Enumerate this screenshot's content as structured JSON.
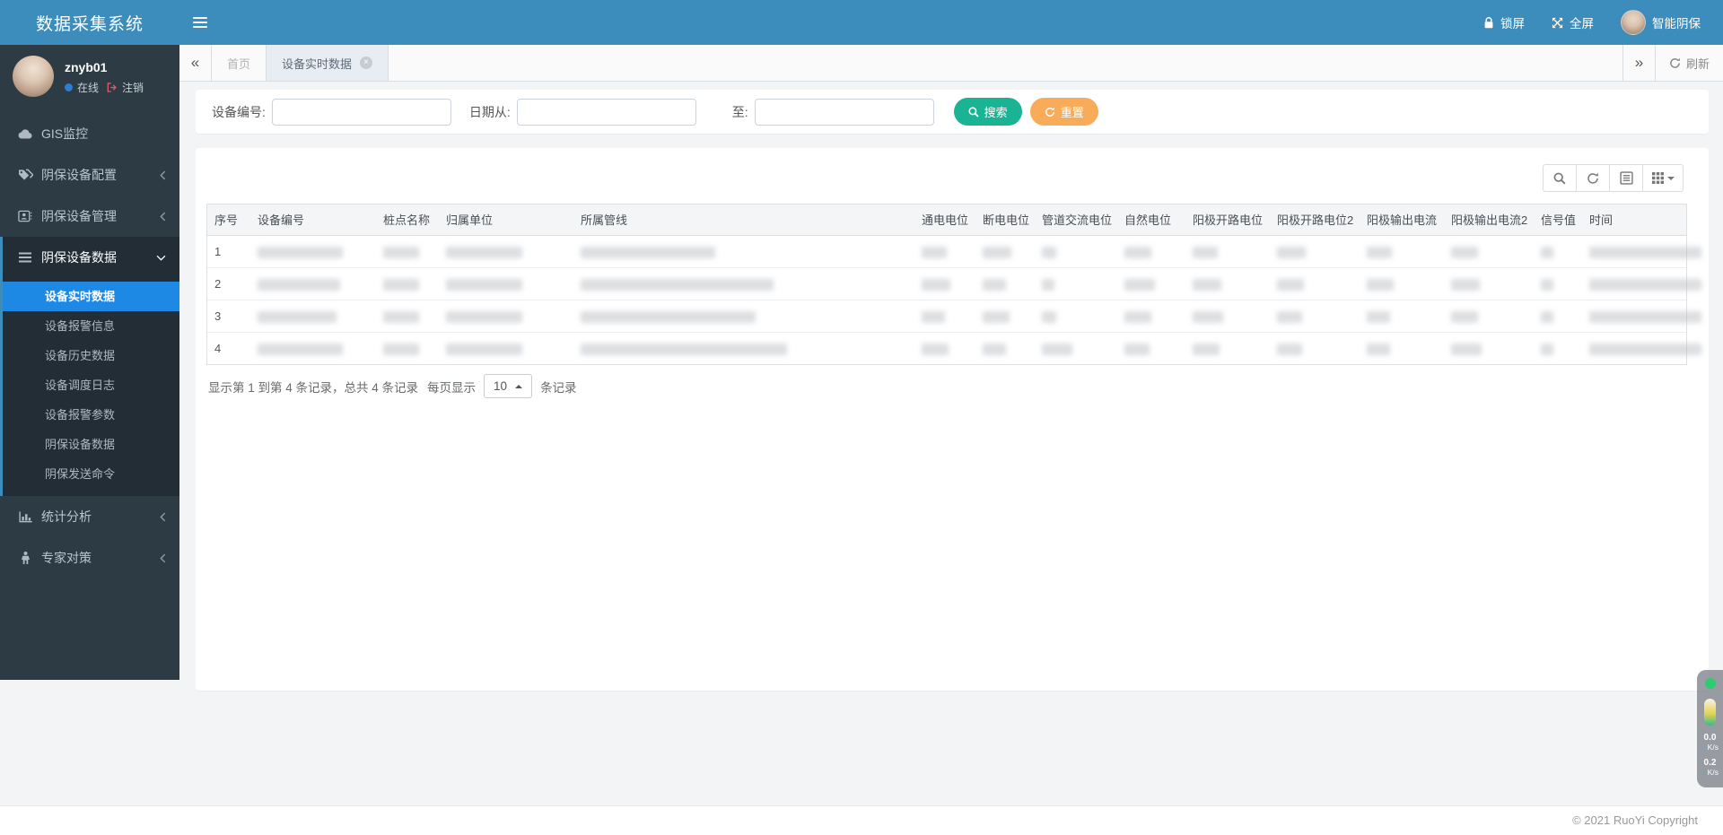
{
  "app": {
    "title": "数据采集系统",
    "copyright": "© 2021 RuoYi Copyright"
  },
  "navbar": {
    "lock_label": "锁屏",
    "fullscreen_label": "全屏",
    "user_name": "智能阴保"
  },
  "sidebar": {
    "user": {
      "name": "znyb01",
      "status": "在线",
      "logout": "注销"
    },
    "menu": [
      {
        "label": "GIS监控",
        "icon": "cloud-icon",
        "state": "leaf"
      },
      {
        "label": "阴保设备配置",
        "icon": "tags-icon",
        "state": "collapsed"
      },
      {
        "label": "阴保设备管理",
        "icon": "address-book-icon",
        "state": "collapsed"
      },
      {
        "label": "阴保设备数据",
        "icon": "bars-icon",
        "state": "open",
        "children": [
          {
            "label": "设备实时数据",
            "active": true
          },
          {
            "label": "设备报警信息",
            "active": false
          },
          {
            "label": "设备历史数据",
            "active": false
          },
          {
            "label": "设备调度日志",
            "active": false
          },
          {
            "label": "设备报警参数",
            "active": false
          },
          {
            "label": "阴保设备数据",
            "active": false
          },
          {
            "label": "阴保发送命令",
            "active": false
          }
        ]
      },
      {
        "label": "统计分析",
        "icon": "bar-chart-icon",
        "state": "collapsed"
      },
      {
        "label": "专家对策",
        "icon": "expert-icon",
        "state": "collapsed"
      }
    ]
  },
  "tabs": {
    "items": [
      {
        "label": "首页",
        "active": false,
        "closable": false
      },
      {
        "label": "设备实时数据",
        "active": true,
        "closable": true
      }
    ],
    "refresh_label": "刷新"
  },
  "search": {
    "device_no_label": "设备编号:",
    "date_from_label": "日期从:",
    "date_to_label": "至:",
    "device_no_value": "",
    "date_from_value": "",
    "date_to_value": "",
    "search_label": "搜索",
    "reset_label": "重置"
  },
  "table": {
    "columns": [
      "序号",
      "设备编号",
      "桩点名称",
      "归属单位",
      "所属管线",
      "通电电位",
      "断电电位",
      "管道交流电位",
      "自然电位",
      "阳极开路电位",
      "阳极开路电位2",
      "阳极输出电流",
      "阳极输出电流2",
      "信号值",
      "时间"
    ],
    "rows": [
      {
        "num": "1",
        "redacted": true,
        "bars": [
          95,
          40,
          85,
          150,
          28,
          32,
          16,
          30,
          28,
          32,
          28,
          30,
          14,
          125
        ]
      },
      {
        "num": "2",
        "redacted": true,
        "bars": [
          92,
          40,
          85,
          215,
          32,
          26,
          14,
          34,
          32,
          30,
          30,
          32,
          14,
          125
        ]
      },
      {
        "num": "3",
        "redacted": true,
        "bars": [
          88,
          40,
          85,
          195,
          26,
          30,
          16,
          30,
          34,
          28,
          26,
          30,
          14,
          125
        ]
      },
      {
        "num": "4",
        "redacted": true,
        "bars": [
          95,
          40,
          85,
          230,
          30,
          26,
          34,
          28,
          30,
          28,
          26,
          34,
          14,
          125
        ]
      }
    ]
  },
  "pagination": {
    "summary": "显示第 1 到第 4 条记录，总共 4 条记录",
    "page_size_prefix": "每页显示",
    "page_size": "10",
    "page_size_suffix": "条记录"
  },
  "speed_widget": {
    "up_value": "0.0",
    "up_unit": "K/s",
    "down_value": "0.2",
    "down_unit": "K/s"
  },
  "icons": [
    "hamburger-icon",
    "lock-icon",
    "fullscreen-icon",
    "cloud-icon",
    "tags-icon",
    "address-book-icon",
    "bars-icon",
    "bar-chart-icon",
    "expert-icon",
    "chevron-left-icon",
    "chevron-down-icon",
    "logout-icon",
    "search-icon",
    "refresh-icon",
    "list-view-icon",
    "grid-columns-icon",
    "close-icon",
    "double-chevron-left-icon",
    "double-chevron-right-icon",
    "caret-up-icon",
    "caret-down-icon",
    "up-arrow-icon",
    "down-arrow-icon"
  ],
  "colors": {
    "navbar_blue": "#3c8dbc",
    "sidebar_bg": "#2c3b44",
    "submenu_bg": "#222d36",
    "active_item_blue": "#1e88e5",
    "search_button_green": "#1ab394",
    "reset_button_orange": "#f8ac59",
    "online_dot_blue": "#2d7dd2",
    "logout_icon_red": "#e0566e",
    "active_tab_bg": "#e8edf3"
  }
}
